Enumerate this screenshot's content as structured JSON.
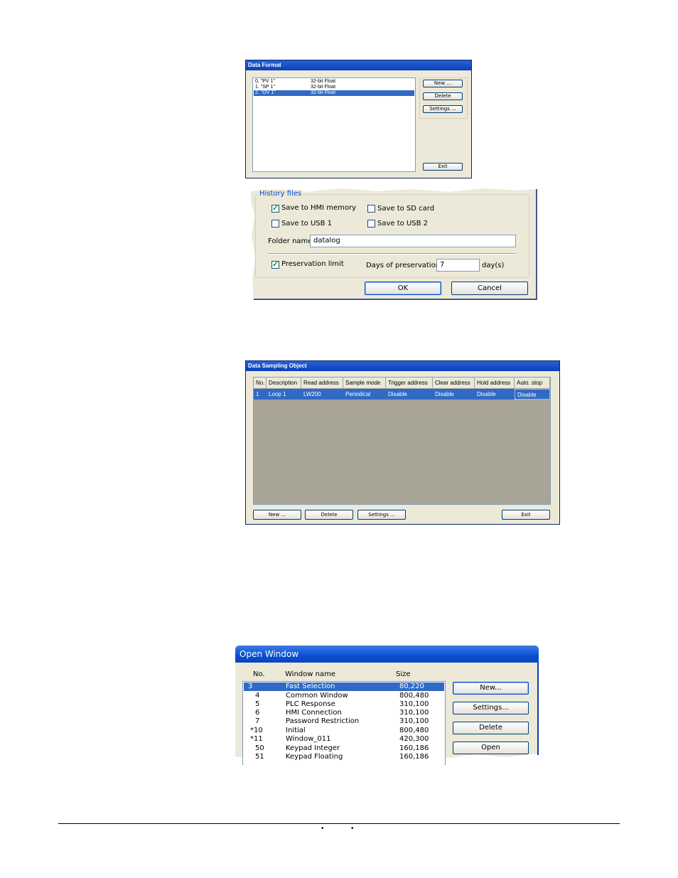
{
  "data_format": {
    "title": "Data Format",
    "rows": [
      {
        "name": "0. \"PV 1\"",
        "type": "32-bit Float",
        "selected": false
      },
      {
        "name": "1. \"SP 1\"",
        "type": "32-bit Float",
        "selected": false
      },
      {
        "name": "2. \"OV 1\"",
        "type": "32-bit Float",
        "selected": true
      }
    ],
    "buttons": {
      "new": "New ...",
      "delete": "Delete",
      "settings": "Settings ...",
      "exit": "Exit"
    }
  },
  "history_files": {
    "group_label": "History files",
    "save_hmi": {
      "label": "Save to HMI memory",
      "checked": true
    },
    "save_sd": {
      "label": "Save to SD card",
      "checked": false
    },
    "save_usb1": {
      "label": "Save to USB 1",
      "checked": false
    },
    "save_usb2": {
      "label": "Save to USB 2",
      "checked": false
    },
    "folder_label": "Folder name :",
    "folder_value": "datalog",
    "preservation": {
      "label": "Preservation limit",
      "checked": true
    },
    "days_label": "Days of preservation :",
    "days_value": "7",
    "days_unit": "day(s)",
    "ok": "OK",
    "cancel": "Cancel"
  },
  "sampling": {
    "title": "Data Sampling Object",
    "columns": [
      "No.",
      "Description",
      "Read address",
      "Sample mode",
      "Trigger address",
      "Clear address",
      "Hold address",
      "Auto. stop"
    ],
    "row": [
      "1",
      "Loop 1",
      "LW200",
      "Periodical",
      "Disable",
      "Disable",
      "Disable",
      "Disable"
    ],
    "buttons": {
      "new": "New ...",
      "delete": "Delete",
      "settings": "Settings ...",
      "exit": "Exit"
    }
  },
  "open_window": {
    "title": "Open Window",
    "headers": {
      "no": "No.",
      "name": "Window name",
      "size": "Size"
    },
    "rows": [
      {
        "no": "3",
        "name": "Fast Selection",
        "size": "80,220",
        "selected": true
      },
      {
        "no": "4",
        "name": "Common Window",
        "size": "800,480",
        "selected": false
      },
      {
        "no": "5",
        "name": "PLC Response",
        "size": "310,100",
        "selected": false
      },
      {
        "no": "6",
        "name": "HMI Connection",
        "size": "310,100",
        "selected": false
      },
      {
        "no": "7",
        "name": "Password Restriction",
        "size": "310,100",
        "selected": false
      },
      {
        "no": "*10",
        "name": "Initial",
        "size": "800,480",
        "selected": false
      },
      {
        "no": "*11",
        "name": "Window_011",
        "size": "420,300",
        "selected": false
      },
      {
        "no": "50",
        "name": "Keypad Integer",
        "size": "160,186",
        "selected": false
      },
      {
        "no": "51",
        "name": "Keypad Floating",
        "size": "160,186",
        "selected": false
      }
    ],
    "buttons": {
      "new": "New...",
      "settings": "Settings...",
      "delete": "Delete",
      "open": "Open"
    }
  },
  "footer": {
    "bullet1": "•",
    "bullet2": "•"
  }
}
